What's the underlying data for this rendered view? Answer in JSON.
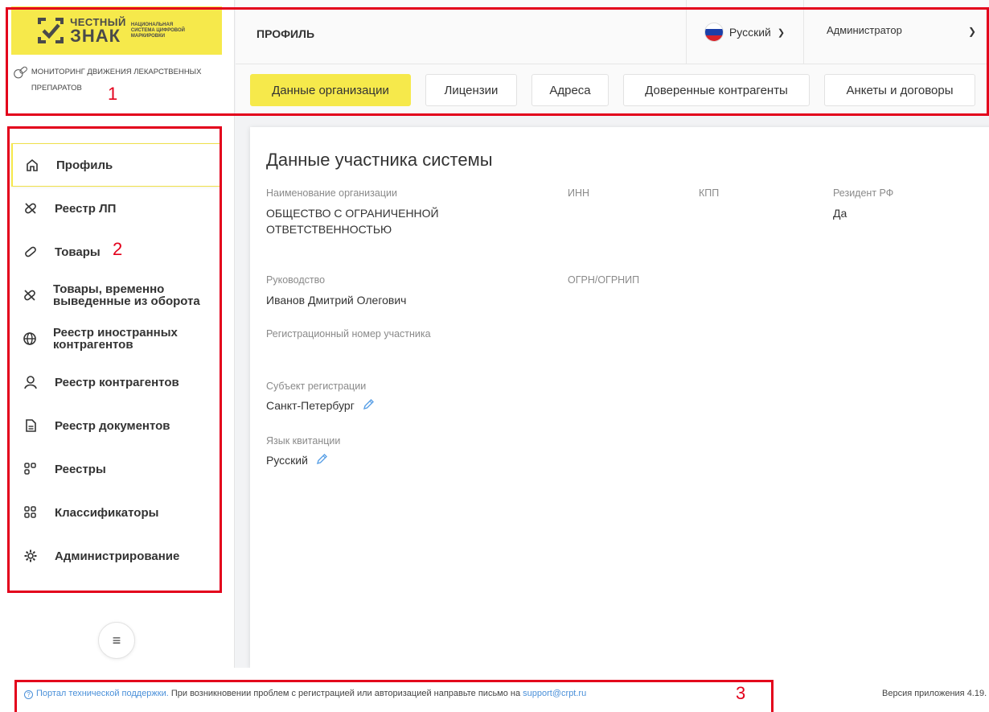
{
  "logo": {
    "word1": "ЧЕСТНЫЙ",
    "word2": "ЗНАК",
    "tagline": "НАЦИОНАЛЬНАЯ СИСТЕМА ЦИФРОВОЙ МАРКИРОВКИ",
    "brand_color": "#f6e94b"
  },
  "app": {
    "subtitle": "МОНИТОРИНГ ДВИЖЕНИЯ ЛЕКАРСТВЕННЫХ ПРЕПАРАТОВ"
  },
  "header": {
    "page_title": "ПРОФИЛЬ",
    "language": "Русский",
    "user": "Администратор"
  },
  "tabs": [
    {
      "label": "Данные организации",
      "active": true
    },
    {
      "label": "Лицензии",
      "active": false
    },
    {
      "label": "Адреса",
      "active": false
    },
    {
      "label": "Доверенные контрагенты",
      "active": false
    },
    {
      "label": "Анкеты и договоры",
      "active": false
    }
  ],
  "sidebar": {
    "items": [
      {
        "label": "Профиль",
        "icon": "home-icon",
        "active": true
      },
      {
        "label": "Реестр ЛП",
        "icon": "pill-strike-icon"
      },
      {
        "label": "Товары",
        "icon": "pill-icon"
      },
      {
        "label": "Товары, временно выведенные из оборота",
        "icon": "pill-strike-icon"
      },
      {
        "label": "Реестр иностранных контрагентов",
        "icon": "globe-icon"
      },
      {
        "label": "Реестр контрагентов",
        "icon": "user-icon"
      },
      {
        "label": "Реестр документов",
        "icon": "document-icon"
      },
      {
        "label": "Реестры",
        "icon": "grid-icon"
      },
      {
        "label": "Классификаторы",
        "icon": "grid-icon"
      },
      {
        "label": "Администрирование",
        "icon": "gear-icon"
      }
    ],
    "menu_icon": "hamburger-icon"
  },
  "content": {
    "title": "Данные участника системы",
    "org_name_label": "Наименование организации",
    "org_name_value": "ОБЩЕСТВО С ОГРАНИЧЕННОЙ ОТВЕТСТВЕННОСТЬЮ",
    "inn_label": "ИНН",
    "kpp_label": "КПП",
    "resident_label": "Резидент РФ",
    "resident_value": "Да",
    "management_label": "Руководство",
    "management_value": "Иванов Дмитрий Олегович",
    "ogrn_label": "ОГРН/ОГРНИП",
    "reg_number_label": "Регистрационный номер участника",
    "region_label": "Субъект регистрации",
    "region_value": "Санкт-Петербург",
    "receipt_lang_label": "Язык квитанции",
    "receipt_lang_value": "Русский"
  },
  "footer": {
    "portal_link": "Портал технической поддержки.",
    "message": " При возникновении проблем с регистрацией или авторизацией направьте письмо на ",
    "email": "support@crpt.ru",
    "version": "Версия приложения 4.19."
  },
  "annotations": {
    "label_1": "1",
    "label_2": "2",
    "label_3": "3",
    "color": "#e3001b"
  }
}
